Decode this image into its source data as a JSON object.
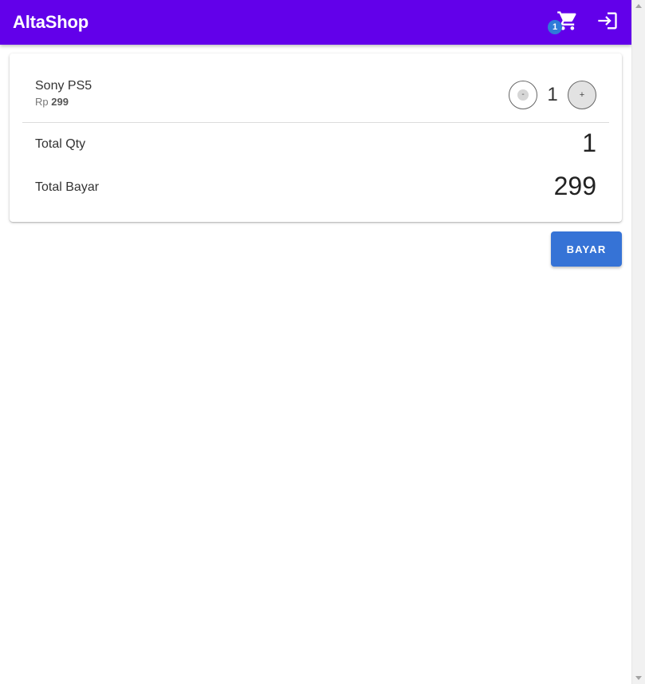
{
  "app_bar": {
    "title": "AltaShop",
    "cart_badge": "1",
    "cart_icon": "shopping-cart-icon",
    "login_icon": "login-icon",
    "background": "#6200ea"
  },
  "cart": {
    "items": [
      {
        "name": "Sony PS5",
        "currency": "Rp",
        "price": "299",
        "quantity": "1",
        "decrement_label": "-",
        "increment_label": "+"
      }
    ],
    "summary": {
      "total_qty_label": "Total Qty",
      "total_qty_value": "1",
      "total_pay_label": "Total Bayar",
      "total_pay_value": "299"
    }
  },
  "actions": {
    "pay_label": "BAYAR",
    "pay_color": "#3673d6"
  }
}
